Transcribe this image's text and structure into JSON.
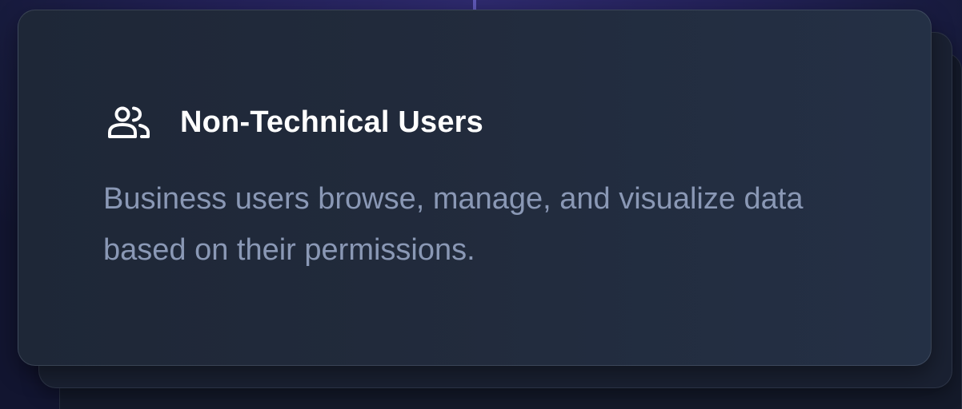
{
  "card": {
    "icon": "users-icon",
    "title": "Non-Technical Users",
    "description": "Business users browse, manage, and visualize data based on their permissions."
  },
  "colors": {
    "background": "#1b1f45",
    "card": "#222b3c",
    "title": "#ffffff",
    "description": "#8a98b5"
  }
}
